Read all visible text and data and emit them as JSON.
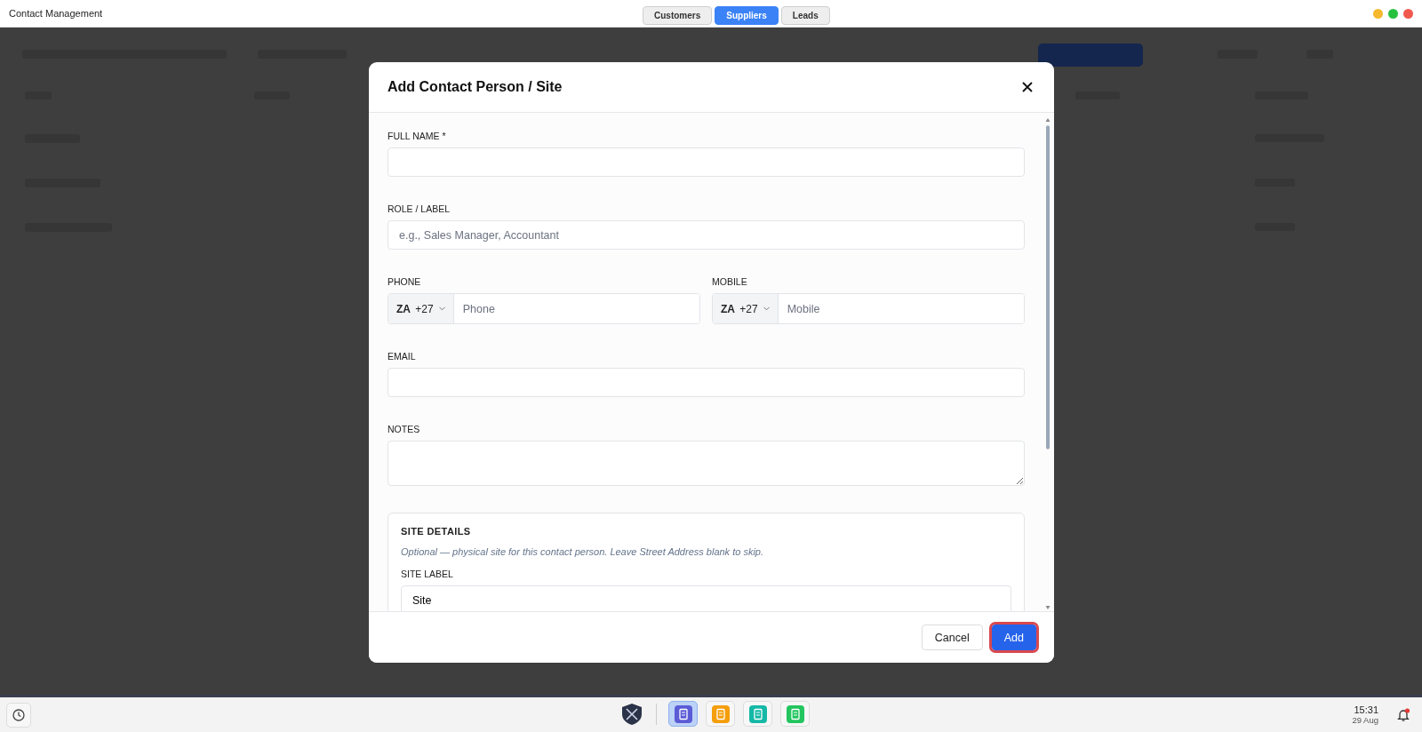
{
  "window": {
    "title": "Contact Management"
  },
  "tabs": [
    {
      "label": "Customers",
      "selected": false
    },
    {
      "label": "Suppliers",
      "selected": true
    },
    {
      "label": "Leads",
      "selected": false
    }
  ],
  "dialog": {
    "title": "Add Contact Person / Site",
    "fields": [
      {
        "kind": "text",
        "label": "FULL NAME *"
      },
      {
        "kind": "text",
        "label": "ROLE / LABEL",
        "placeholder": "e.g., Sales Manager, Accountant"
      },
      {
        "kind": "phones",
        "items": [
          {
            "label": "PHONE",
            "country": "ZA",
            "code": "+27",
            "placeholder": "Phone"
          },
          {
            "label": "MOBILE",
            "country": "ZA",
            "code": "+27",
            "placeholder": "Mobile"
          }
        ]
      },
      {
        "kind": "text",
        "label": "EMAIL"
      },
      {
        "kind": "textarea",
        "label": "NOTES"
      }
    ],
    "site_details": {
      "title": "SITE DETAILS",
      "hint": "Optional — physical site for this contact person. Leave Street Address blank to skip.",
      "site_label": {
        "label": "SITE LABEL",
        "value": "Site"
      }
    },
    "buttons": [
      {
        "label": "Cancel",
        "kind": "secondary",
        "focused": false
      },
      {
        "label": "Add",
        "kind": "primary",
        "focused": true
      }
    ]
  },
  "taskbar": {
    "apps": [
      {
        "color": "#5b5bd6",
        "selected": true
      },
      {
        "color": "#f59e0b",
        "selected": false
      },
      {
        "color": "#14b8a6",
        "selected": false
      },
      {
        "color": "#22c55e",
        "selected": false
      }
    ],
    "time": "15:31",
    "date": "29 Aug",
    "unread_notifications": true
  }
}
